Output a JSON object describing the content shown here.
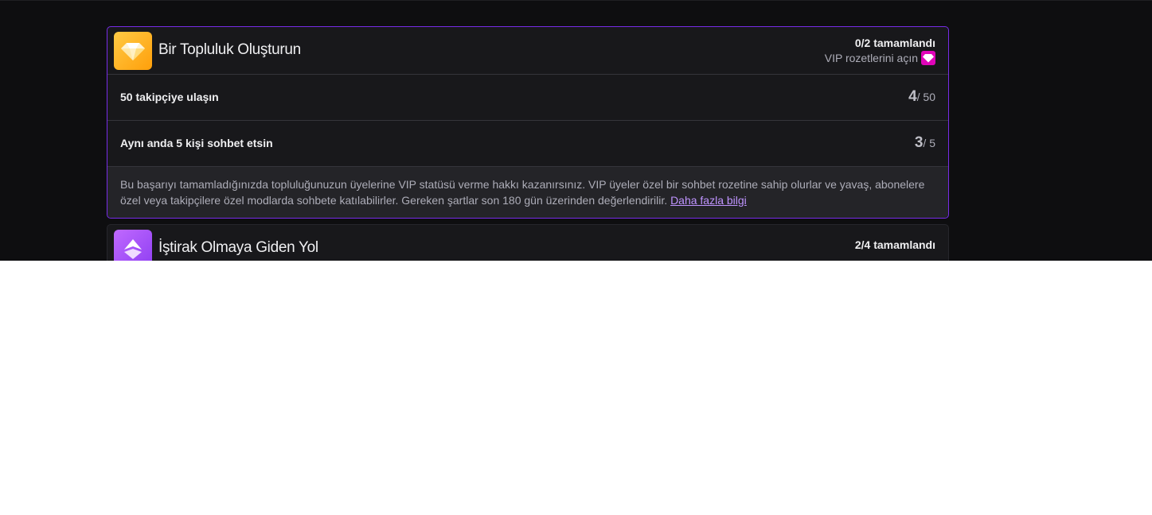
{
  "achievements": [
    {
      "title": "Bir Topluluk Oluşturun",
      "status": "0/2 tamamlandı",
      "reward_label": "VIP rozetlerini açın",
      "badge_icon": "diamond-icon",
      "reward_icon": "vip-gem-icon",
      "accent_color": "#772ce8",
      "requirements": [
        {
          "label": "50 takipçiye ulaşın",
          "current": "4",
          "target": "/ 50"
        },
        {
          "label": "Aynı anda 5 kişi sohbet etsin",
          "current": "3",
          "target": "/ 5"
        }
      ],
      "description": "Bu başarıyı tamamladığınızda topluluğunuzun üyelerine VIP statüsü verme hakkı kazanırsınız. VIP üyeler özel bir sohbet rozetine sahip olurlar ve yavaş, abonelere özel veya takipçilere özel modlarda sohbete katılabilirler. Gereken şartlar son 180 gün üzerinden değerlendirilir.",
      "learn_more": "Daha fazla bilgi"
    },
    {
      "title": "İştirak Olmaya Giden Yol",
      "status": "2/4 tamamlandı",
      "badge_icon": "affiliate-icon"
    }
  ]
}
